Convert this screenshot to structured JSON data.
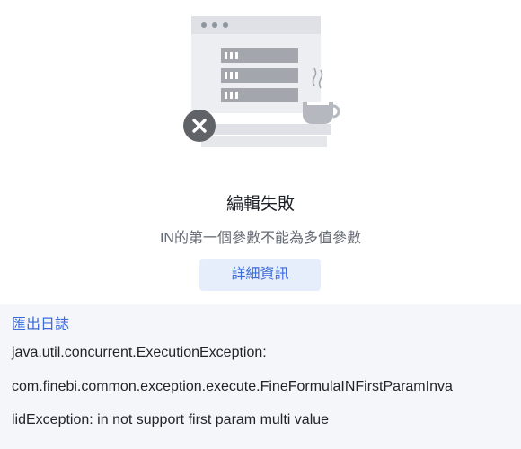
{
  "dialog": {
    "title": "編輯失敗",
    "message": "IN的第一個參數不能為多值參數",
    "details_button_label": "詳細資訊"
  },
  "details": {
    "export_log_label": "匯出日誌",
    "lines": [
      "java.util.concurrent.ExecutionException:",
      "com.finebi.common.exception.execute.FineFormulaINFirstParamInva",
      "lidException: in not support first param multi value"
    ]
  },
  "colors": {
    "accent": "#3c6bdb",
    "button_bg": "#e6edfb",
    "panel_bg": "#f4f6fa"
  },
  "icons": {
    "illustration": "server-window-with-coffee-illustration",
    "error": "close-icon"
  }
}
